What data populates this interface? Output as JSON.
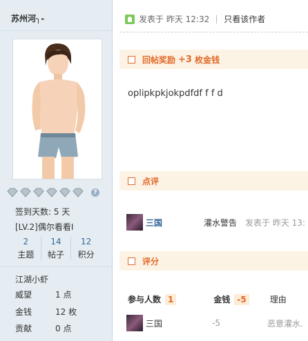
{
  "sidebar": {
    "username": "苏州河╮-",
    "stats": {
      "checkin": "签到天数: 5 天",
      "level": "[LV.2]偶尔看看I"
    },
    "counts": [
      {
        "num": "2",
        "label": "主题"
      },
      {
        "num": "14",
        "label": "帖子"
      },
      {
        "num": "12",
        "label": "积分"
      }
    ],
    "rank": "江湖小虾",
    "info": [
      {
        "key": "威望",
        "value": "1 点"
      },
      {
        "key": "金钱",
        "value": "12 枚"
      },
      {
        "key": "贡献",
        "value": "0 点"
      }
    ],
    "medal_count": 6,
    "help_icon": "?"
  },
  "post": {
    "posted_label": "发表于 昨天 12:32",
    "only_author": "只看该作者",
    "reward_label": "回帖奖励",
    "reward_amount": "+3",
    "reward_unit": "枚金钱",
    "content": "oplipkpkjokpdfdf f f d"
  },
  "comment": {
    "section_title": "点评",
    "user": "三国",
    "tag": "灌水警告",
    "time": "发表于 昨天 13:"
  },
  "rating": {
    "section_title": "评分",
    "participants_label": "参与人数",
    "participants_count": "1",
    "money_label": "金钱",
    "money_total": "-5",
    "reason_label": "理由",
    "row": {
      "user": "三国",
      "money": "-5",
      "reason": "恶意灌水."
    }
  },
  "colors": {
    "accent": "#e06a2a",
    "link": "#336699",
    "sidebar_bg": "#e5edf2",
    "band_bg": "#fdf3e4"
  }
}
